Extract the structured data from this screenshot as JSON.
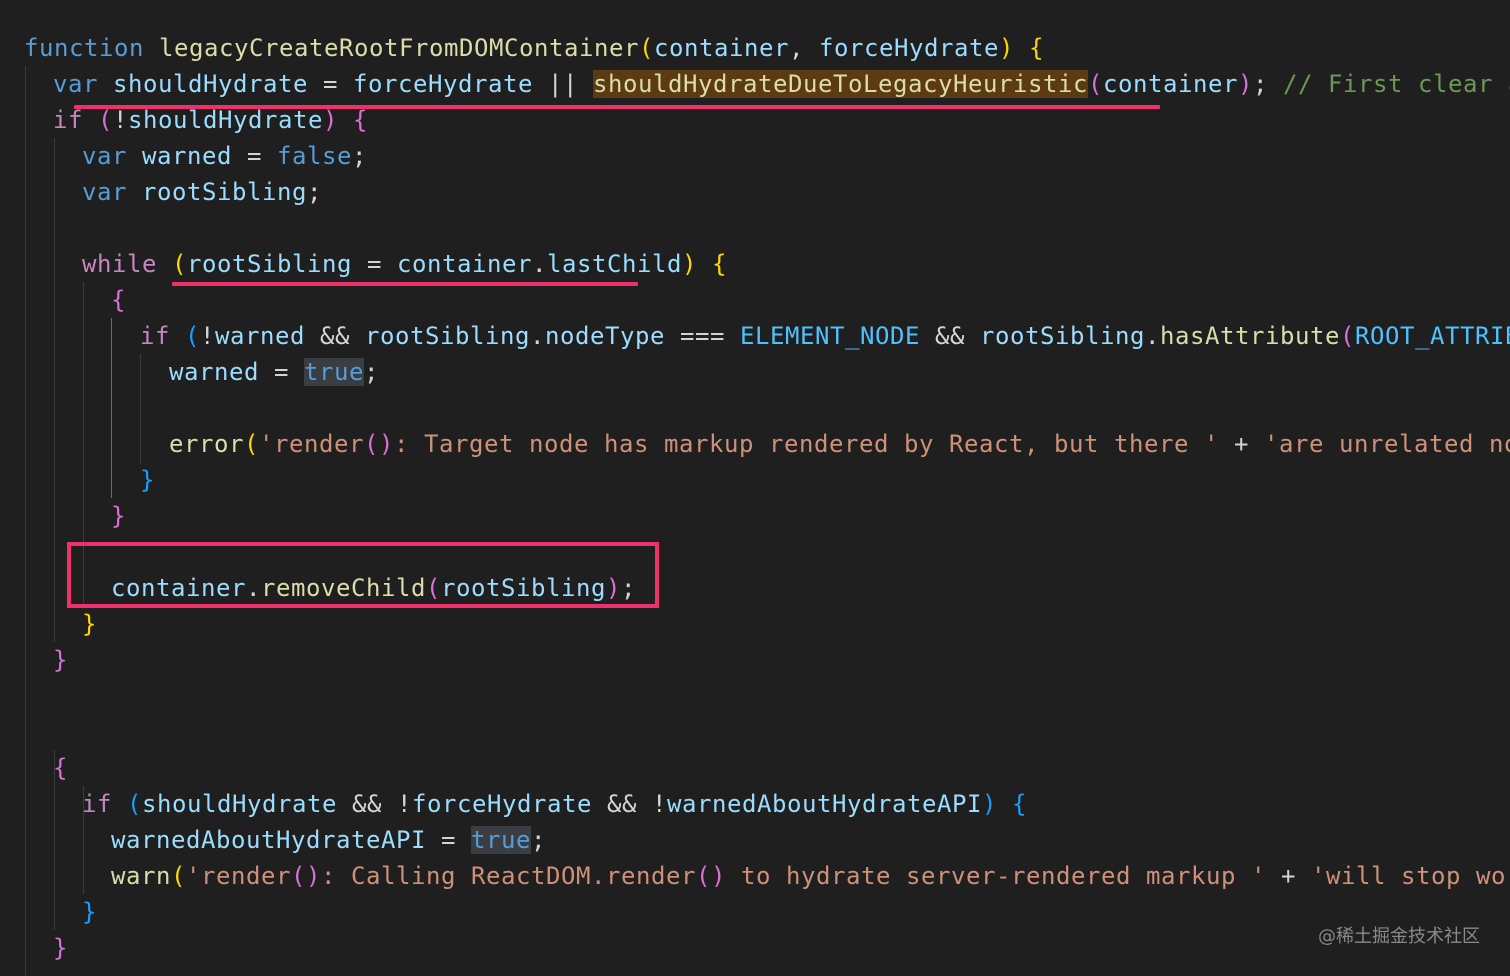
{
  "colors": {
    "background": "#1f1f1f",
    "keyword": "#569cd6",
    "control": "#c586c0",
    "function": "#dcdcaa",
    "variable": "#9cdcfe",
    "constant": "#4fc1ff",
    "string": "#ce9178",
    "comment": "#6a9955",
    "bracket1": "#ffd700",
    "bracket2": "#da70d6",
    "bracket3": "#179fff",
    "punctuation": "#d4d4d4",
    "annotation": "#f0306b"
  },
  "editor": {
    "lines": [
      [
        [
          "function",
          "keyword"
        ],
        [
          " ",
          "punctuation"
        ],
        [
          "legacyCreateRootFromDOMContainer",
          "function"
        ],
        [
          "(",
          "bracket1"
        ],
        [
          "container",
          "variable"
        ],
        [
          ", ",
          "punctuation"
        ],
        [
          "forceHydrate",
          "variable"
        ],
        [
          ")",
          "bracket1"
        ],
        [
          " ",
          "punctuation"
        ],
        [
          "{",
          "bracket1"
        ]
      ],
      [
        [
          "var",
          "keyword"
        ],
        [
          " ",
          "punctuation"
        ],
        [
          "shouldHydrate",
          "variable"
        ],
        [
          " = ",
          "punctuation"
        ],
        [
          "forceHydrate",
          "variable"
        ],
        [
          " || ",
          "punctuation"
        ],
        [
          "shouldHydrateDueToLegacyHeuristic",
          "function-hl"
        ],
        [
          "(",
          "bracket2"
        ],
        [
          "container",
          "variable"
        ],
        [
          ")",
          "bracket2"
        ],
        [
          "; ",
          "punctuation"
        ],
        [
          "// First clear any",
          "comment"
        ]
      ],
      [
        [
          "if",
          "control"
        ],
        [
          " ",
          "punctuation"
        ],
        [
          "(",
          "bracket2"
        ],
        [
          "!",
          "punctuation"
        ],
        [
          "shouldHydrate",
          "variable"
        ],
        [
          ")",
          "bracket2"
        ],
        [
          " ",
          "punctuation"
        ],
        [
          "{",
          "bracket2"
        ]
      ],
      [
        [
          "var",
          "keyword"
        ],
        [
          " ",
          "punctuation"
        ],
        [
          "warned",
          "variable"
        ],
        [
          " = ",
          "punctuation"
        ],
        [
          "false",
          "keyword"
        ],
        [
          ";",
          "punctuation"
        ]
      ],
      [
        [
          "var",
          "keyword"
        ],
        [
          " ",
          "punctuation"
        ],
        [
          "rootSibling",
          "variable"
        ],
        [
          ";",
          "punctuation"
        ]
      ],
      [],
      [
        [
          "while",
          "control"
        ],
        [
          " ",
          "punctuation"
        ],
        [
          "(",
          "bracket1"
        ],
        [
          "rootSibling",
          "variable"
        ],
        [
          " = ",
          "punctuation"
        ],
        [
          "container",
          "variable"
        ],
        [
          ".",
          "punctuation"
        ],
        [
          "lastChild",
          "variable"
        ],
        [
          ")",
          "bracket1"
        ],
        [
          " ",
          "punctuation"
        ],
        [
          "{",
          "bracket1"
        ]
      ],
      [
        [
          "{",
          "bracket2"
        ]
      ],
      [
        [
          "if",
          "control"
        ],
        [
          " ",
          "punctuation"
        ],
        [
          "(",
          "bracket3"
        ],
        [
          "!",
          "punctuation"
        ],
        [
          "warned",
          "variable"
        ],
        [
          " && ",
          "punctuation"
        ],
        [
          "rootSibling",
          "variable"
        ],
        [
          ".",
          "punctuation"
        ],
        [
          "nodeType",
          "variable"
        ],
        [
          " === ",
          "punctuation"
        ],
        [
          "ELEMENT_NODE",
          "constant"
        ],
        [
          " && ",
          "punctuation"
        ],
        [
          "rootSibling",
          "variable"
        ],
        [
          ".",
          "punctuation"
        ],
        [
          "hasAttribute",
          "function"
        ],
        [
          "(",
          "bracket2"
        ],
        [
          "ROOT_ATTRIBUTE",
          "constant"
        ]
      ],
      [
        [
          "warned",
          "variable"
        ],
        [
          " = ",
          "punctuation"
        ],
        [
          "true",
          "keyword-hl"
        ],
        [
          ";",
          "punctuation"
        ]
      ],
      [],
      [
        [
          "error",
          "function"
        ],
        [
          "(",
          "bracket1"
        ],
        [
          "'render",
          "string"
        ],
        [
          "()",
          "bracket2"
        ],
        [
          ": Target node has markup rendered by React, but there '",
          "string"
        ],
        [
          " + ",
          "punctuation"
        ],
        [
          "'are unrelated nodes",
          "string"
        ]
      ],
      [
        [
          "}",
          "bracket3"
        ]
      ],
      [
        [
          "}",
          "bracket2"
        ]
      ],
      [],
      [
        [
          "container",
          "variable"
        ],
        [
          ".",
          "punctuation"
        ],
        [
          "removeChild",
          "function"
        ],
        [
          "(",
          "bracket2"
        ],
        [
          "rootSibling",
          "variable"
        ],
        [
          ")",
          "bracket2"
        ],
        [
          ";",
          "punctuation"
        ]
      ],
      [
        [
          "}",
          "bracket1"
        ]
      ],
      [
        [
          "}",
          "bracket2"
        ]
      ],
      [],
      [],
      [
        [
          "{",
          "bracket2"
        ]
      ],
      [
        [
          "if",
          "control"
        ],
        [
          " ",
          "punctuation"
        ],
        [
          "(",
          "bracket3"
        ],
        [
          "shouldHydrate",
          "variable"
        ],
        [
          " && ",
          "punctuation"
        ],
        [
          "!",
          "punctuation"
        ],
        [
          "forceHydrate",
          "variable"
        ],
        [
          " && ",
          "punctuation"
        ],
        [
          "!",
          "punctuation"
        ],
        [
          "warnedAboutHydrateAPI",
          "variable"
        ],
        [
          ")",
          "bracket3"
        ],
        [
          " ",
          "punctuation"
        ],
        [
          "{",
          "bracket3"
        ]
      ],
      [
        [
          "warnedAboutHydrateAPI",
          "variable"
        ],
        [
          " = ",
          "punctuation"
        ],
        [
          "true",
          "keyword-hl"
        ],
        [
          ";",
          "punctuation"
        ]
      ],
      [],
      [
        [
          "warn",
          "function"
        ],
        [
          "(",
          "bracket1"
        ],
        [
          "'render",
          "string"
        ],
        [
          "()",
          "bracket2"
        ],
        [
          ": Calling ReactDOM.render",
          "string"
        ],
        [
          "()",
          "bracket2"
        ],
        [
          " to hydrate server-rendered markup '",
          "string"
        ],
        [
          " + ",
          "punctuation"
        ],
        [
          "'will stop workin",
          "string"
        ]
      ],
      [
        [
          "}",
          "bracket3"
        ]
      ],
      [
        [
          "}",
          "bracket2"
        ]
      ]
    ]
  },
  "watermark": "@稀土掘金技术社区"
}
